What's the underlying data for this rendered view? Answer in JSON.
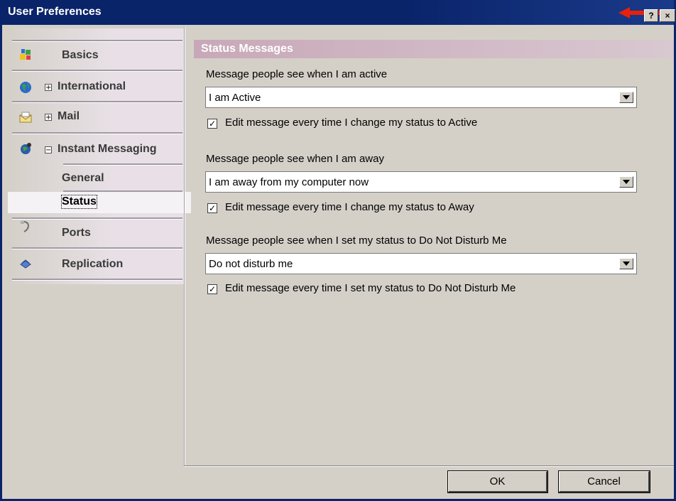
{
  "window": {
    "title": "User Preferences",
    "help_glyph": "?",
    "close_glyph": "×"
  },
  "sidebar": {
    "items": [
      {
        "label": "Basics",
        "icon": "basics-icon"
      },
      {
        "label": "International",
        "icon": "globe-icon",
        "expander": "+"
      },
      {
        "label": "Mail",
        "icon": "mail-icon",
        "expander": "+"
      },
      {
        "label": "Instant Messaging",
        "icon": "instant-messaging-icon",
        "expander": "−"
      },
      {
        "label": "Ports",
        "icon": "ports-icon"
      },
      {
        "label": "Replication",
        "icon": "replication-icon"
      }
    ],
    "sub_items": [
      {
        "label": "General"
      },
      {
        "label": "Status",
        "selected": true
      }
    ]
  },
  "content": {
    "section_title": "Status Messages",
    "groups": [
      {
        "label": "Message people see when I am active",
        "value": "I am Active",
        "checkbox_label": "Edit message every time I change my status to Active",
        "checked": true
      },
      {
        "label": "Message people see when I am away",
        "value": "I am away from my computer now",
        "checkbox_label": "Edit message every time I change my status to Away",
        "checked": true
      },
      {
        "label": "Message people see when I set my status to Do Not Disturb Me",
        "value": "Do not disturb me",
        "checkbox_label": "Edit message every time I set my status to Do Not Disturb Me",
        "checked": true
      }
    ],
    "check_glyph": "✓"
  },
  "buttons": {
    "ok": "OK",
    "cancel": "Cancel"
  },
  "colors": {
    "titlebar": "#0a246a",
    "section_header": "#c8a8b8",
    "annotation_arrow": "#e8200c"
  }
}
